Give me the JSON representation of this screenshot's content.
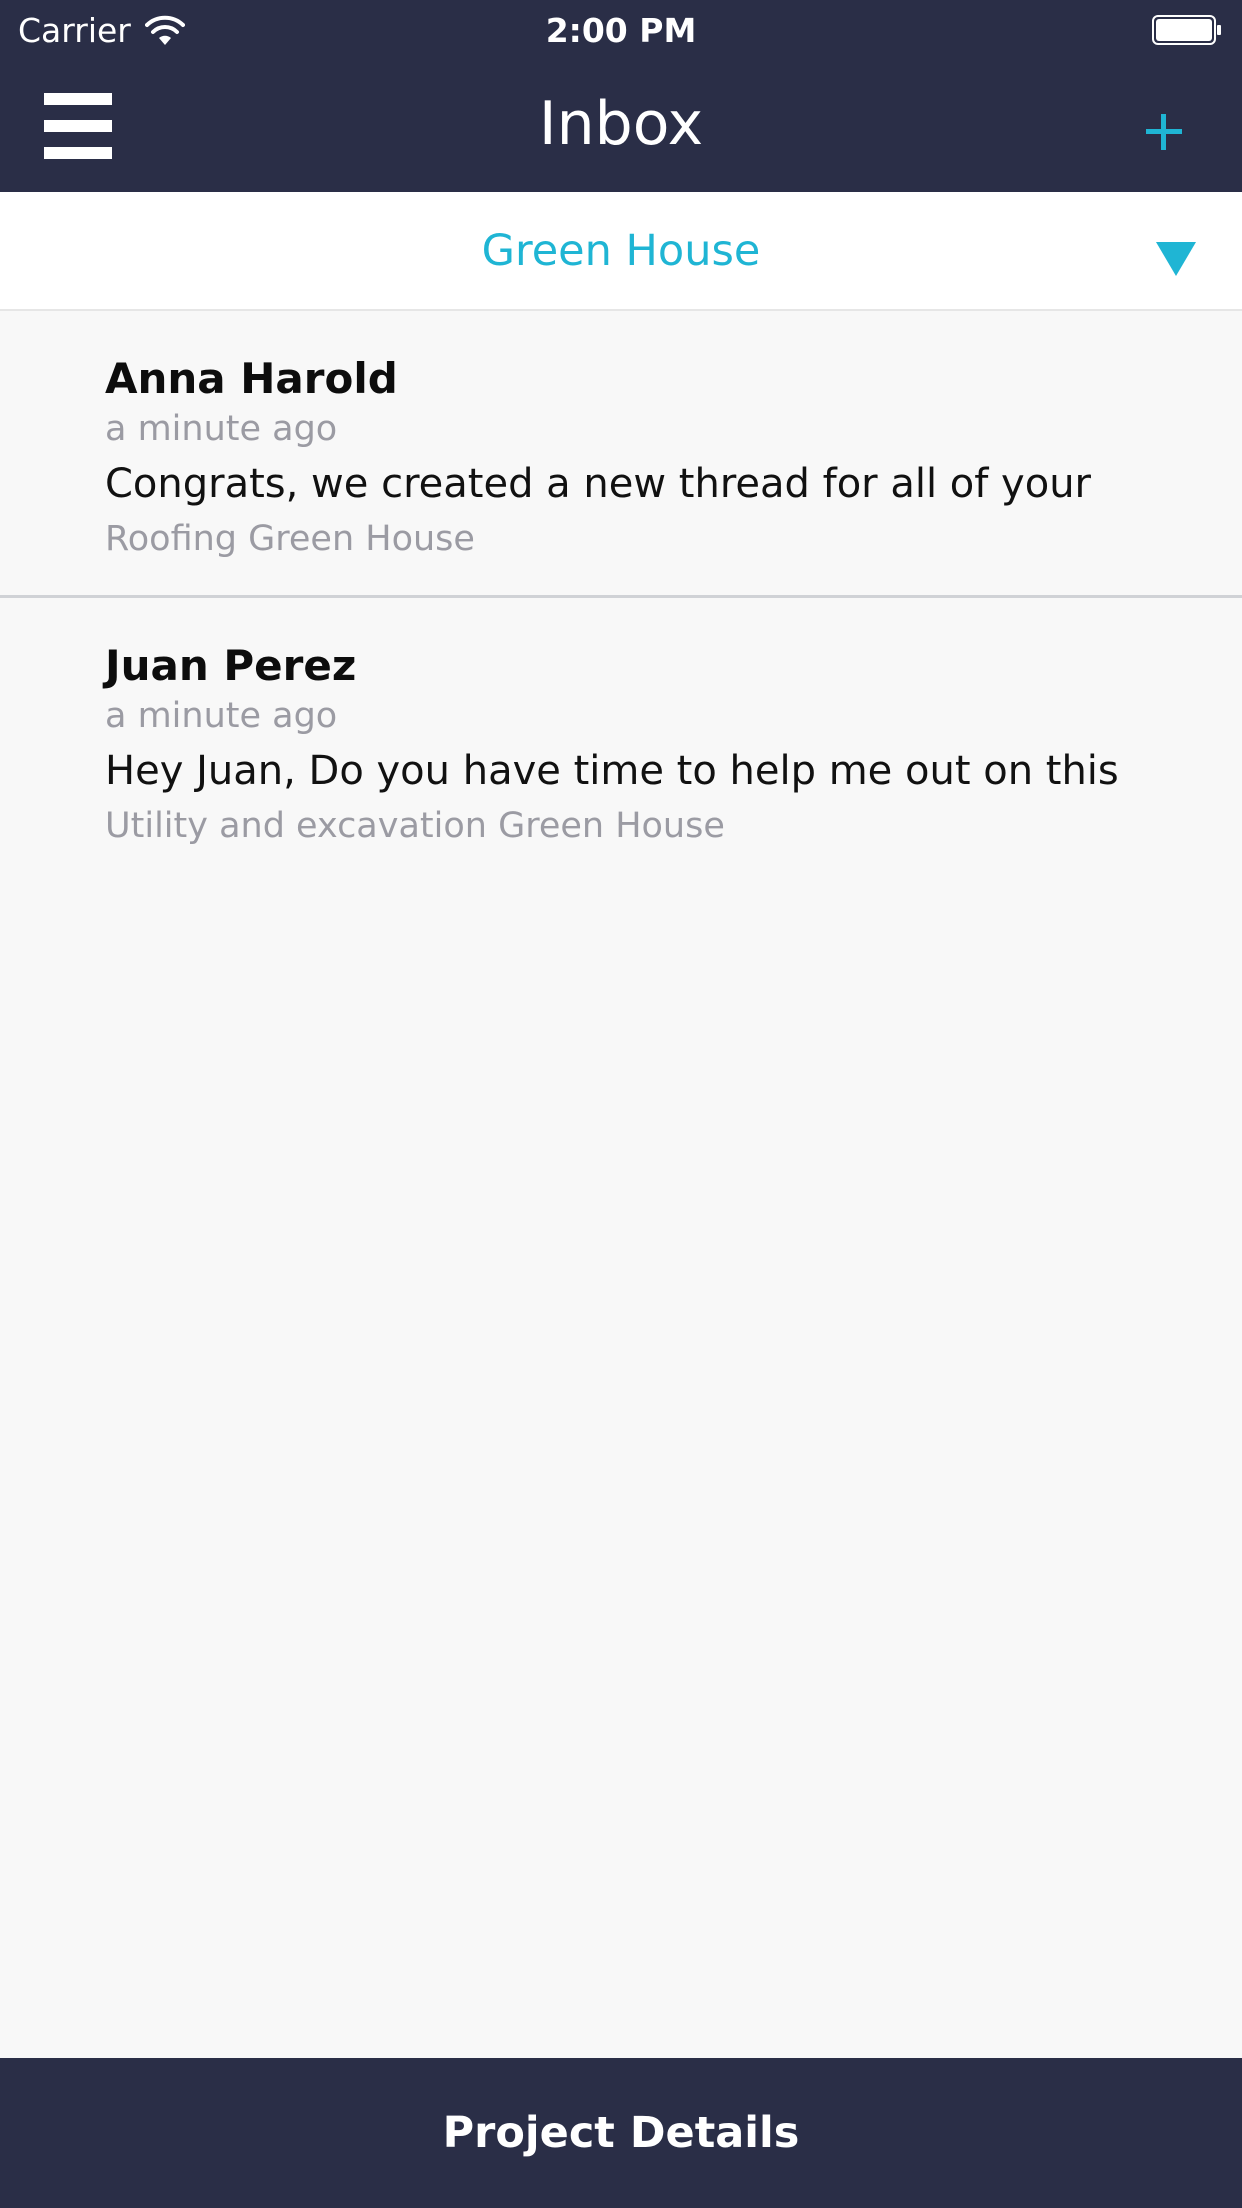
{
  "status_bar": {
    "carrier": "Carrier",
    "time": "2:00 PM",
    "wifi_icon": "wifi-icon",
    "battery_icon": "battery-icon"
  },
  "nav": {
    "title": "Inbox",
    "menu_icon": "hamburger-menu-icon",
    "add_icon": "plus-icon",
    "add_color": "#1fb5d4"
  },
  "filter": {
    "label": "Green House",
    "dropdown_icon": "triangle-down-icon",
    "accent_color": "#1fb5d4"
  },
  "threads": [
    {
      "sender": "Anna Harold",
      "time": "a minute ago",
      "preview": "Congrats, we created a new thread for all of your",
      "project": "Roofing Green House"
    },
    {
      "sender": "Juan Perez",
      "time": "a minute ago",
      "preview": "Hey Juan, Do you have time to help me out on this",
      "project": "Utility and excavation Green House"
    }
  ],
  "footer": {
    "label": "Project Details"
  },
  "colors": {
    "header_bg": "#2a2e47",
    "accent": "#1fb5d4",
    "secondary_text": "#9b9ba3",
    "page_bg": "#f8f8f8"
  }
}
